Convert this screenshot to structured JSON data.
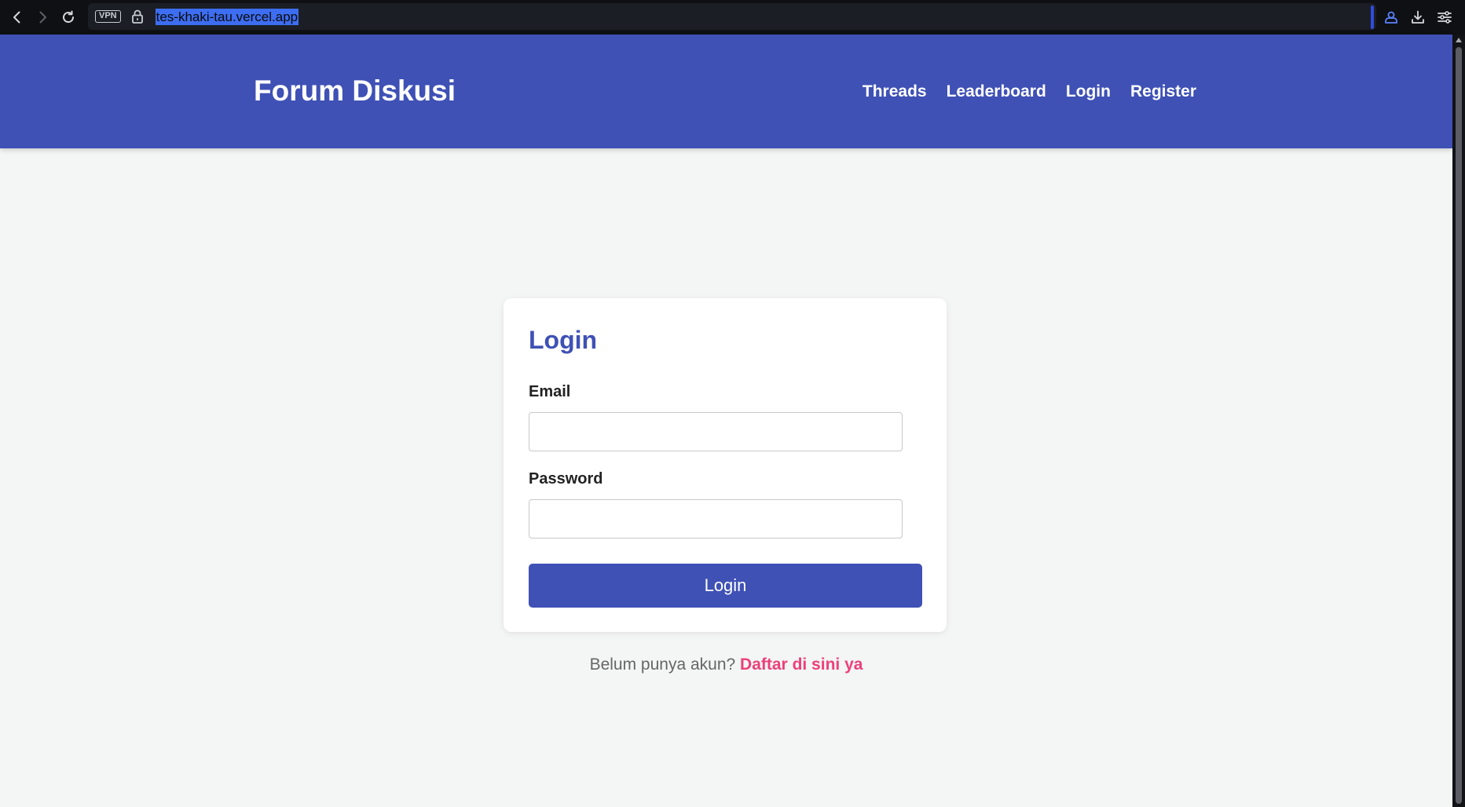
{
  "browser": {
    "vpn_label": "VPN",
    "url": "tes-khaki-tau.vercel.app"
  },
  "header": {
    "brand": "Forum Diskusi",
    "nav": [
      {
        "label": "Threads"
      },
      {
        "label": "Leaderboard"
      },
      {
        "label": "Login"
      },
      {
        "label": "Register"
      }
    ]
  },
  "login": {
    "title": "Login",
    "email_label": "Email",
    "email_value": "",
    "password_label": "Password",
    "password_value": "",
    "submit_label": "Login"
  },
  "register_prompt": {
    "text": "Belum punya akun?",
    "link_label": "Daftar di sini ya"
  },
  "colors": {
    "primary": "#3f51b5",
    "accent_link": "#ec407a",
    "background": "#f4f5f5"
  },
  "icons": {
    "back": "back-arrow-icon",
    "forward": "forward-arrow-icon",
    "reload": "reload-icon",
    "lock": "lock-icon",
    "profile": "profile-icon",
    "download": "download-icon",
    "settings": "settings-sliders-icon"
  }
}
